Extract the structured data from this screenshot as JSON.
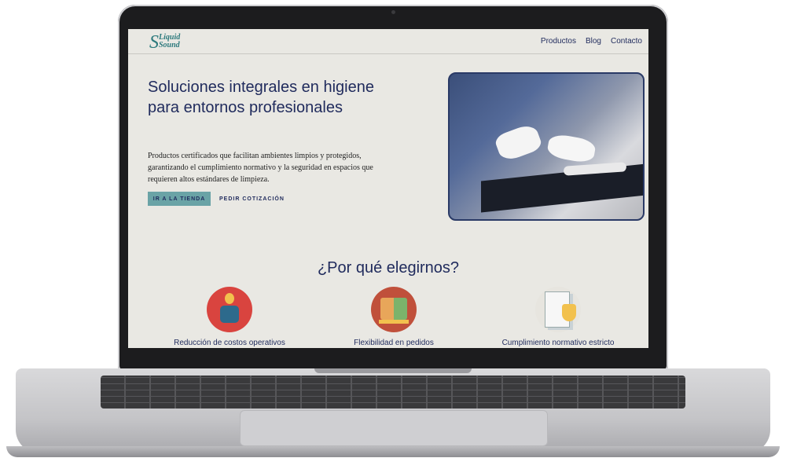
{
  "site": {
    "logo": {
      "line1": "Liquid",
      "line2": "Sound",
      "mark": "S"
    },
    "nav": {
      "items": [
        "Productos",
        "Blog",
        "Contacto"
      ]
    }
  },
  "hero": {
    "title": "Soluciones integrales en higiene para entornos profesionales",
    "description": "Productos certificados que facilitan ambientes limpios y protegidos, garantizando el cumplimiento normativo y la seguridad en espacios que requieren altos estándares de limpieza.",
    "primary_cta": "IR A LA TIENDA",
    "secondary_cta": "PEDIR COTIZACIÓN",
    "image": "gloved-hands-cleaning-counter"
  },
  "why": {
    "title": "¿Por qué elegirnos?",
    "features": [
      {
        "label": "Reducción de costos operativos",
        "icon": "cost-reduction-icon"
      },
      {
        "label": "Flexibilidad en pedidos",
        "icon": "boxes-cart-icon"
      },
      {
        "label": "Cumplimiento normativo estricto",
        "icon": "checklist-shield-icon"
      }
    ]
  },
  "colors": {
    "primary": "#1f2a5c",
    "accent": "#6aa3a6",
    "background": "#e9e8e3"
  }
}
